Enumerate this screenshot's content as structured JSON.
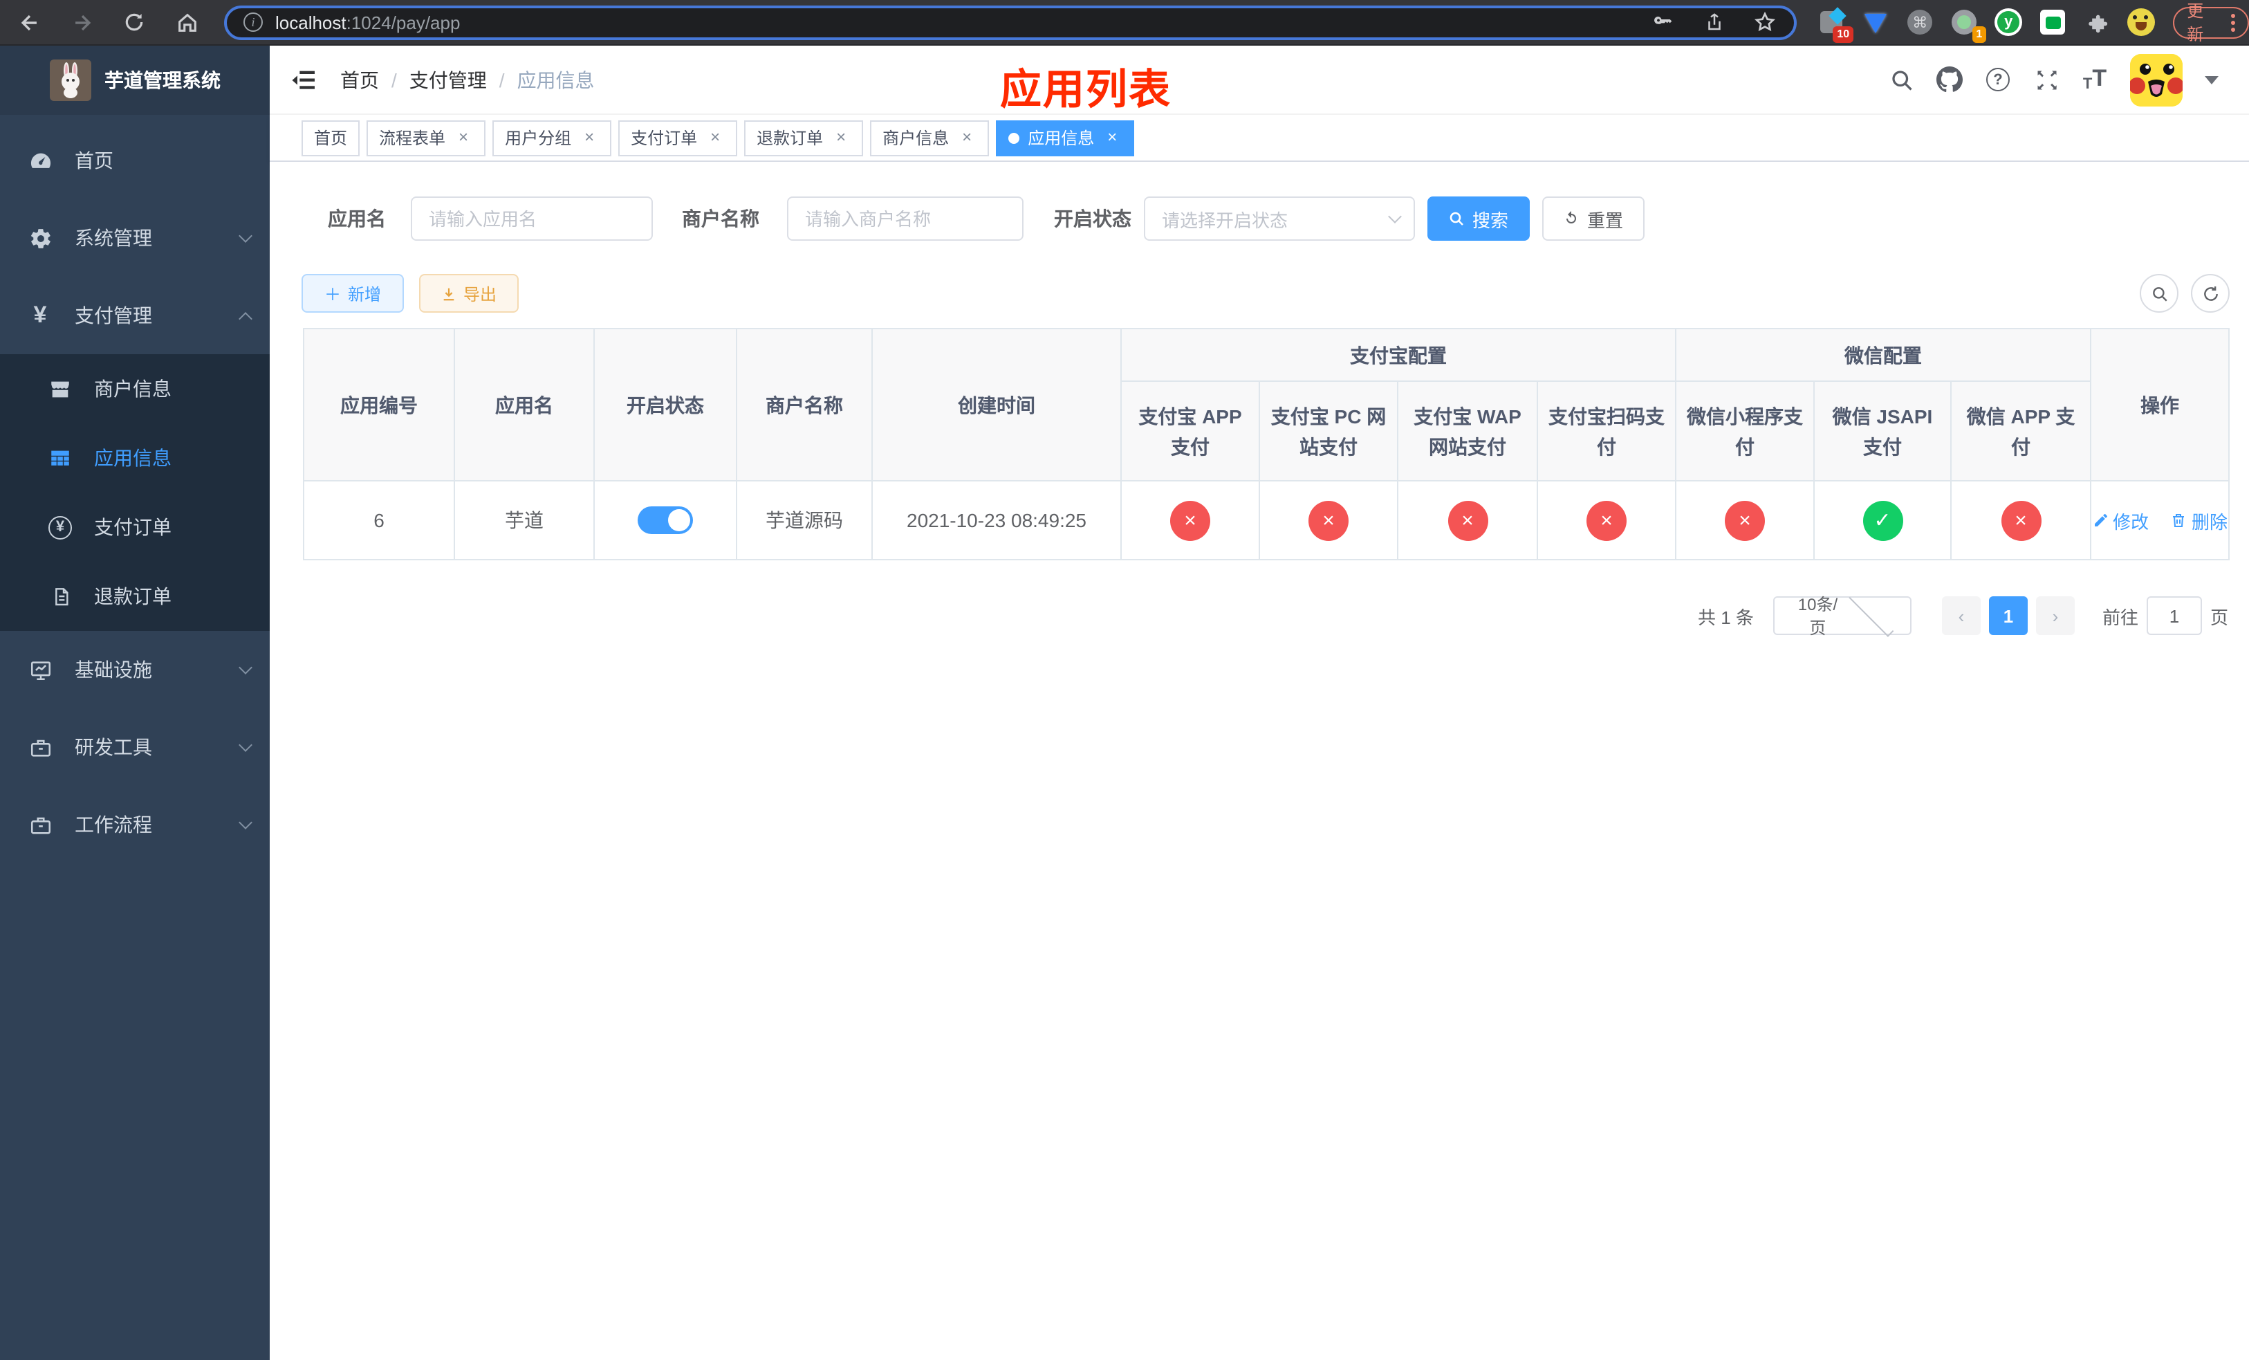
{
  "colors": {
    "primary": "#409eff",
    "success": "#13ce66",
    "danger": "#f45454",
    "warning": "#e6a23c",
    "annotation": "#ff2a00",
    "sidebar_bg": "#304156",
    "submenu_bg": "#1f2d3d"
  },
  "browser": {
    "url": {
      "host": "localhost",
      "path": ":1024/pay/app"
    },
    "update_label": "更新",
    "ext_badges": {
      "pinned": "10",
      "meet": "1"
    }
  },
  "sidebar": {
    "title": "芋道管理系统",
    "menu": [
      {
        "label": "首页"
      },
      {
        "label": "系统管理"
      },
      {
        "label": "支付管理"
      },
      {
        "label": "商户信息"
      },
      {
        "label": "应用信息"
      },
      {
        "label": "支付订单"
      },
      {
        "label": "退款订单"
      },
      {
        "label": "基础设施"
      },
      {
        "label": "研发工具"
      },
      {
        "label": "工作流程"
      }
    ]
  },
  "header": {
    "breadcrumb": [
      "首页",
      "支付管理",
      "应用信息"
    ],
    "annotation": "应用列表"
  },
  "tags": [
    {
      "label": "首页"
    },
    {
      "label": "流程表单"
    },
    {
      "label": "用户分组"
    },
    {
      "label": "支付订单"
    },
    {
      "label": "退款订单"
    },
    {
      "label": "商户信息"
    },
    {
      "label": "应用信息"
    }
  ],
  "filter": {
    "app_name_label": "应用名",
    "app_name_placeholder": "请输入应用名",
    "merchant_label": "商户名称",
    "merchant_placeholder": "请输入商户名称",
    "status_label": "开启状态",
    "status_placeholder": "请选择开启状态",
    "search_label": "搜索",
    "reset_label": "重置"
  },
  "toolbar": {
    "add_label": "新增",
    "export_label": "导出"
  },
  "table": {
    "columns": {
      "app_id": "应用编号",
      "app_name": "应用名",
      "open_status": "开启状态",
      "merchant_name": "商户名称",
      "create_time": "创建时间",
      "alipay_group": "支付宝配置",
      "wechat_group": "微信配置",
      "alipay_app": "支付宝 APP 支付",
      "alipay_pc": "支付宝 PC 网站支付",
      "alipay_wap": "支付宝 WAP 网站支付",
      "alipay_qr": "支付宝扫码支付",
      "wx_mini": "微信小程序支付",
      "wx_jsapi": "微信 JSAPI 支付",
      "wx_app": "微信 APP 支付",
      "actions": "操作"
    },
    "row": {
      "app_id": "6",
      "app_name": "芋道",
      "open_status": true,
      "merchant_name": "芋道源码",
      "create_time": "2021-10-23 08:49:25",
      "statuses": [
        "no",
        "no",
        "no",
        "no",
        "no",
        "yes",
        "no"
      ],
      "edit_label": "修改",
      "delete_label": "删除"
    }
  },
  "pagination": {
    "total_text": "共 1 条",
    "page_size": "10条/页",
    "current_page": "1",
    "goto_label": "前往",
    "goto_value": "1",
    "page_suffix": "页"
  }
}
